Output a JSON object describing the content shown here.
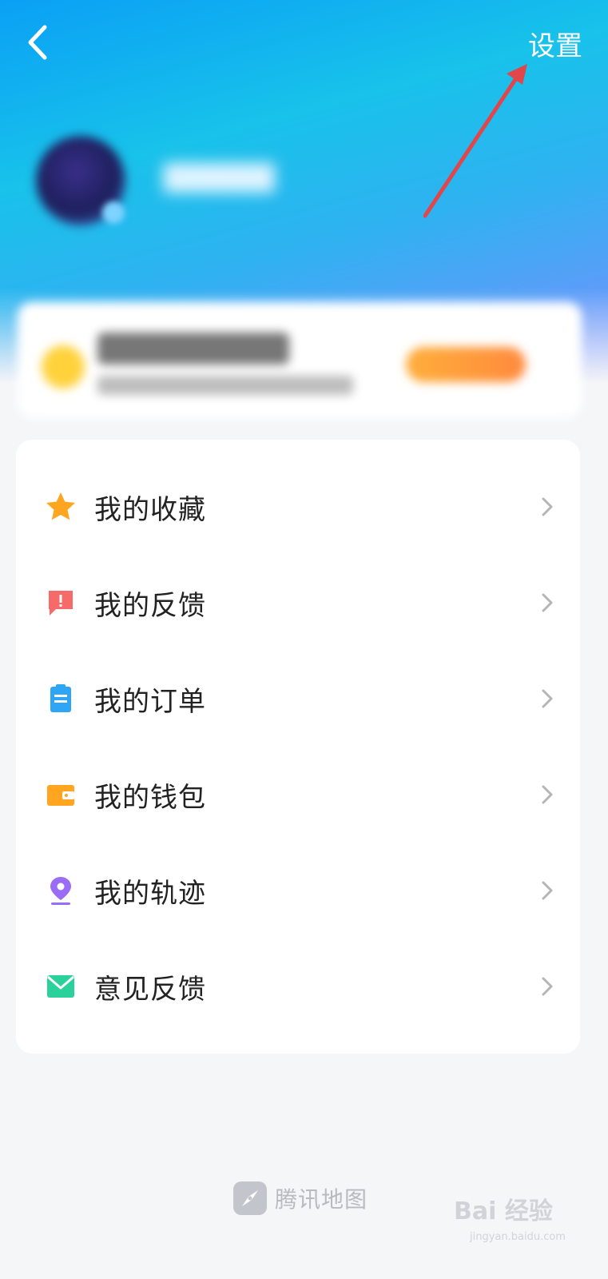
{
  "header": {
    "settings_label": "设置"
  },
  "menu": {
    "items": [
      {
        "label": "我的收藏",
        "icon": "star-icon",
        "color": "#ffa51f"
      },
      {
        "label": "我的反馈",
        "icon": "feedback-alert-icon",
        "color": "#f76a6a"
      },
      {
        "label": "我的订单",
        "icon": "clipboard-icon",
        "color": "#2ea6f5"
      },
      {
        "label": "我的钱包",
        "icon": "wallet-icon",
        "color": "#ffa51f"
      },
      {
        "label": "我的轨迹",
        "icon": "location-pin-icon",
        "color": "#9b6cf5"
      },
      {
        "label": "意见反馈",
        "icon": "mail-icon",
        "color": "#2bd19a"
      }
    ]
  },
  "footer": {
    "brand_name": "腾讯地图",
    "watermark": "Bai 经验",
    "watermark_url": "jingyan.baidu.com"
  },
  "colors": {
    "header_start": "#0aa0f5",
    "header_end": "#7f8cff",
    "annotation_arrow": "#e0464a"
  }
}
